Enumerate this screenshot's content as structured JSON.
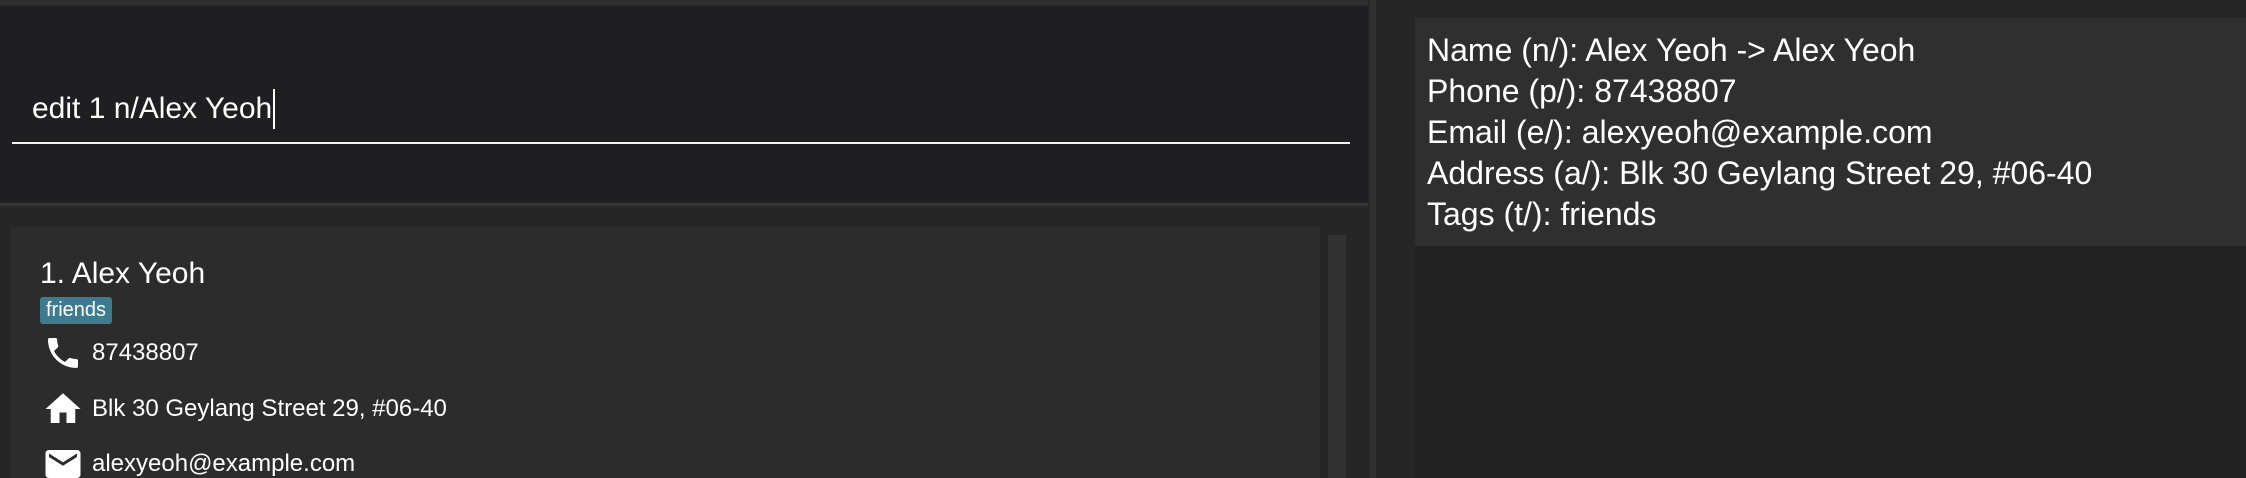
{
  "command_box": {
    "value": "edit 1 n/Alex Yeoh"
  },
  "person_list": {
    "items": [
      {
        "index_name": "1. Alex Yeoh",
        "tags": [
          "friends"
        ],
        "phone": "87438807",
        "address": "Blk 30 Geylang Street 29, #06-40",
        "email": "alexyeoh@example.com"
      }
    ]
  },
  "result_display": {
    "lines": [
      "Name (n/): Alex Yeoh -> Alex Yeoh",
      "Phone (p/): 87438807",
      "Email (e/): alexyeoh@example.com",
      "Address (a/): Blk 30 Geylang Street 29, #06-40",
      "Tags (t/): friends"
    ]
  },
  "icons": {
    "phone": "phone-icon",
    "address": "home-icon",
    "email": "mail-icon"
  },
  "colors": {
    "tag_background": "#3e7b91",
    "text": "#ffffff"
  }
}
